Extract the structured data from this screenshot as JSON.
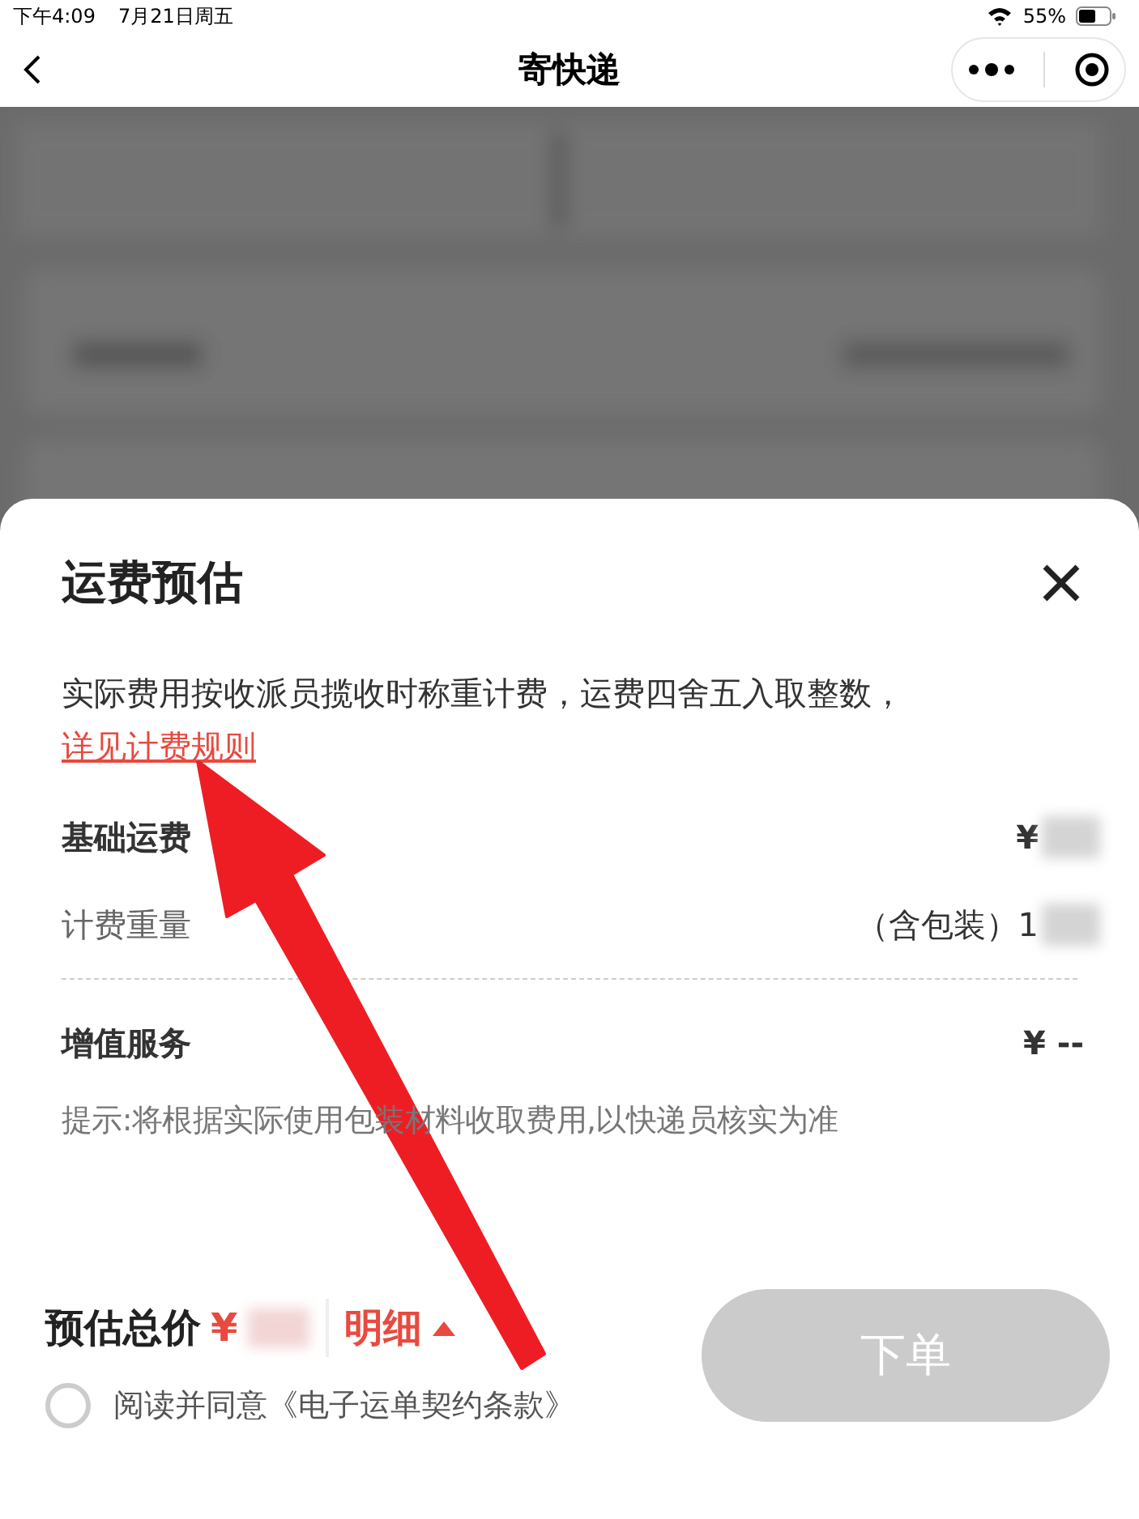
{
  "status_bar": {
    "time": "下午4:09",
    "date": "7月21日周五",
    "battery": "55%"
  },
  "nav": {
    "title": "寄快递"
  },
  "sheet": {
    "title": "运费预估",
    "note": "实际费用按收派员揽收时称重计费，运费四舍五入取整数，",
    "rule_link": "详见计费规则",
    "sections": [
      {
        "rows": [
          {
            "kind": "main",
            "label": "基础运费",
            "value": "¥",
            "blurred": true
          },
          {
            "kind": "sub",
            "label": "计费重量",
            "value": "（含包装）1",
            "blurred": true
          }
        ]
      },
      {
        "rows": [
          {
            "kind": "main",
            "label": "增值服务",
            "value": "¥ --",
            "blurred": false
          },
          {
            "kind": "tip",
            "label": "提示:将根据实际使用包装材料收取费用,以快递员核实为准"
          }
        ]
      }
    ]
  },
  "footer": {
    "total_label": "预估总价",
    "currency": "¥",
    "total_blurred": true,
    "detail": "明细",
    "agree": {
      "text": "阅读并同意《电子运单契约条款》",
      "checked": false
    },
    "submit": {
      "label": "下单",
      "disabled": true
    }
  }
}
